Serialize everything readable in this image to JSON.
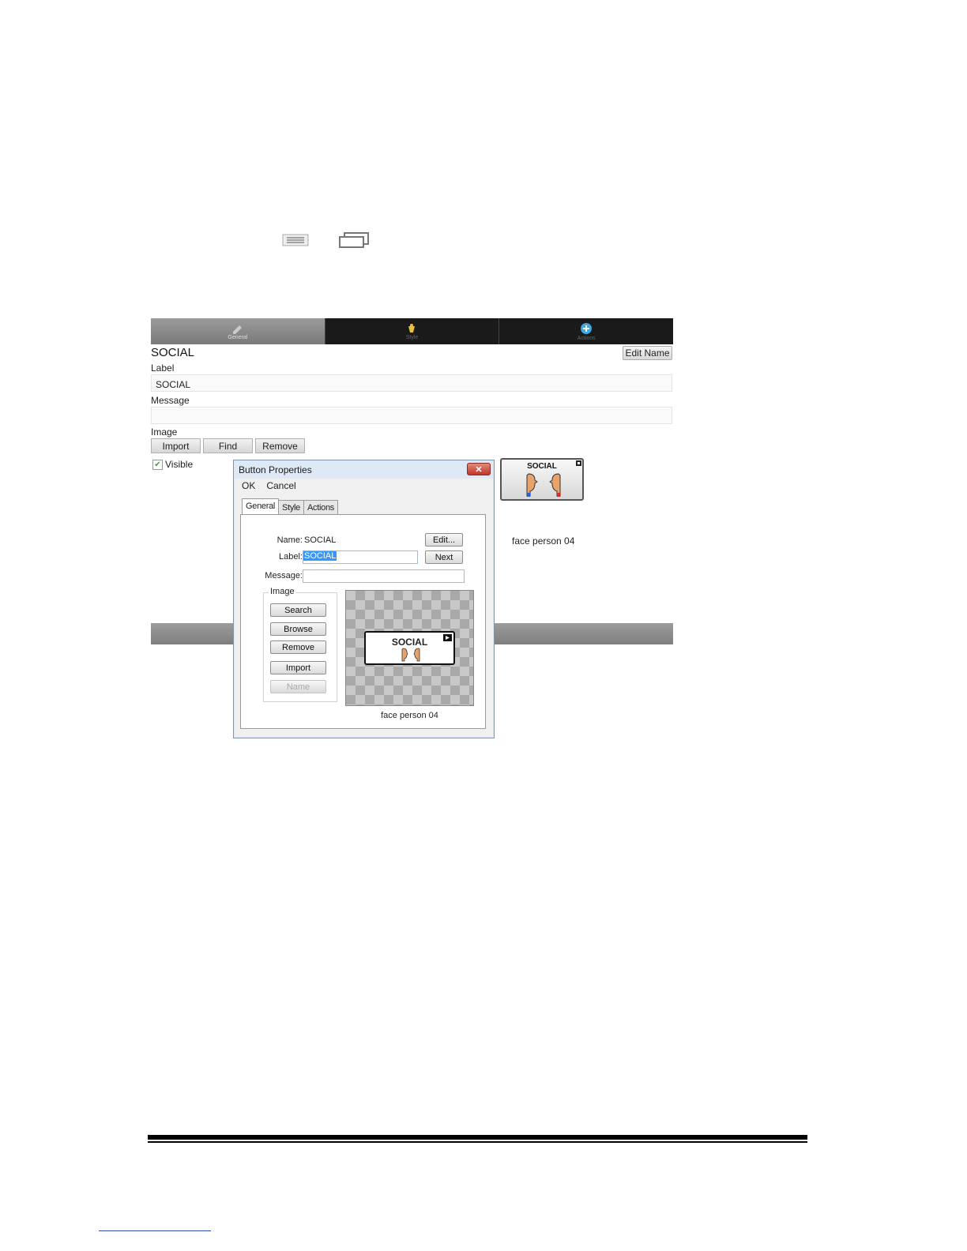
{
  "tabs": [
    {
      "label": "General",
      "icon": "pencil-icon",
      "active": true
    },
    {
      "label": "Style",
      "icon": "paint-bucket-icon",
      "active": false
    },
    {
      "label": "Actions",
      "icon": "plus-circle-icon",
      "active": false
    }
  ],
  "editor": {
    "title": "SOCIAL",
    "edit_name_label": "Edit Name",
    "label_caption": "Label",
    "label_value": "SOCIAL",
    "message_caption": "Message",
    "message_value": "",
    "image_caption": "Image",
    "import_label": "Import",
    "find_label": "Find",
    "remove_label": "Remove",
    "visible_label": "Visible",
    "visible_checked": true,
    "preview_text": "SOCIAL",
    "image_name": "face person 04"
  },
  "dialog": {
    "title": "Button Properties",
    "close_label": "✕",
    "menu": {
      "ok": "OK",
      "cancel": "Cancel"
    },
    "tabs": [
      "General",
      "Style",
      "Actions"
    ],
    "name_label": "Name:",
    "name_value": "SOCIAL",
    "label_label": "Label:",
    "label_value": "SOCIAL",
    "message_label": "Message:",
    "message_value": "",
    "edit_button": "Edit...",
    "next_button": "Next",
    "image_group": "Image",
    "buttons": {
      "search": "Search",
      "browse": "Browse",
      "remove": "Remove",
      "import": "Import",
      "name": "Name"
    },
    "preview_text": "SOCIAL",
    "image_name": "face person 04"
  },
  "colors": {
    "accent_tab": "#8a8a8a",
    "dialog_frame": "#dfe9f5",
    "close_red": "#c1362a",
    "selection": "#3399ff"
  }
}
